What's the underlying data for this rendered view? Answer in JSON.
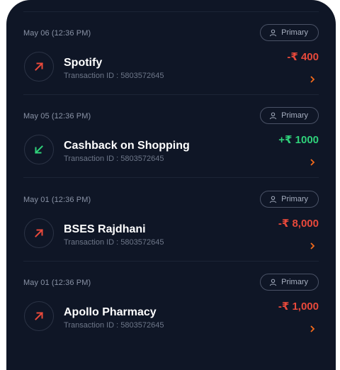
{
  "transactions": [
    {
      "date": "May 06 (12:36 PM)",
      "badge": "Primary",
      "name": "Spotify",
      "txid": "Transaction ID : 5803572645",
      "amount": "-₹ 400",
      "direction": "debit",
      "icon": "arrow-up-right-icon"
    },
    {
      "date": "May 05 (12:36 PM)",
      "badge": "Primary",
      "name": "Cashback on Shopping",
      "txid": "Transaction ID : 5803572645",
      "amount": "+₹ 1000",
      "direction": "credit",
      "icon": "arrow-down-left-icon"
    },
    {
      "date": "May 01 (12:36 PM)",
      "badge": "Primary",
      "name": "BSES Rajdhani",
      "txid": "Transaction ID : 5803572645",
      "amount": "-₹ 8,000",
      "direction": "debit",
      "icon": "arrow-up-right-icon"
    },
    {
      "date": "May 01 (12:36 PM)",
      "badge": "Primary",
      "name": "Apollo Pharmacy",
      "txid": "Transaction ID : 5803572645",
      "amount": "-₹ 1,000",
      "direction": "debit",
      "icon": "arrow-up-right-icon"
    }
  ],
  "colors": {
    "background": "#0f1626",
    "debit": "#e8493b",
    "credit": "#2fd17a",
    "chevron": "#f26a1b"
  }
}
